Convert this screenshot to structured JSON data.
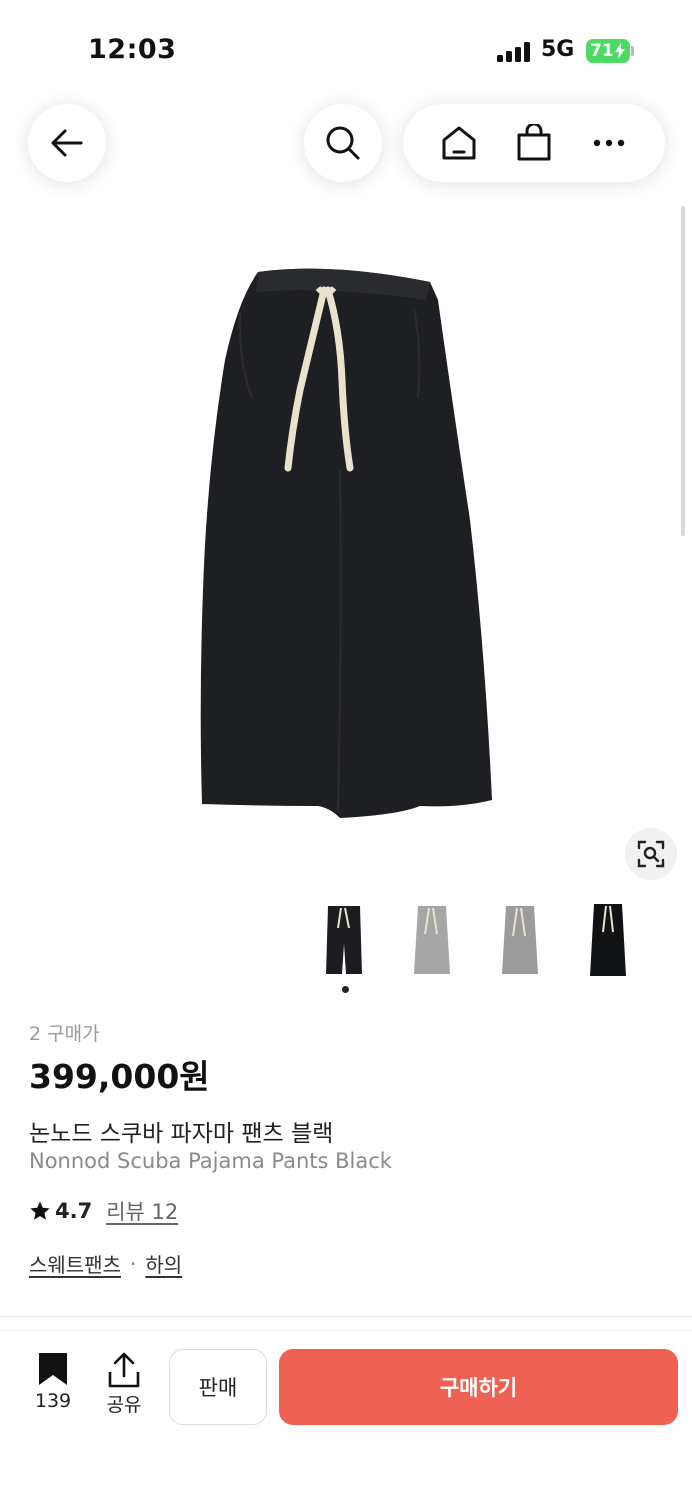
{
  "status_bar": {
    "time": "12:03",
    "network": "5G",
    "battery": "71"
  },
  "nav": {
    "back_icon": "arrow-left-icon",
    "search_icon": "search-icon",
    "home_icon": "home-icon",
    "shop_icon": "shopping-bag-icon",
    "more_icon": "more-horizontal-icon"
  },
  "gallery": {
    "lens_icon": "image-search-icon",
    "thumbnails": [
      {
        "color": "#1c1d20",
        "name": "black"
      },
      {
        "color": "#a6a6a6",
        "name": "light-gray"
      },
      {
        "color": "#9c9c9c",
        "name": "gray"
      },
      {
        "color": "#111214",
        "name": "black-alt"
      }
    ],
    "selected_index": 0
  },
  "product": {
    "buyers": "2 구매가",
    "price": "399,000원",
    "name_ko": "논노드 스쿠바 파자마 팬츠 블랙",
    "name_en": "Nonnod Scuba Pajama Pants Black",
    "rating": "4.7",
    "review_link": "리뷰 12",
    "category_1": "스웨트팬츠",
    "category_separator": "·",
    "category_2": "하의"
  },
  "bottom_bar": {
    "bookmark_count": "139",
    "share_label": "공유",
    "sell_label": "판매",
    "buy_label": "구매하기",
    "buy_color": "#ef6253"
  }
}
